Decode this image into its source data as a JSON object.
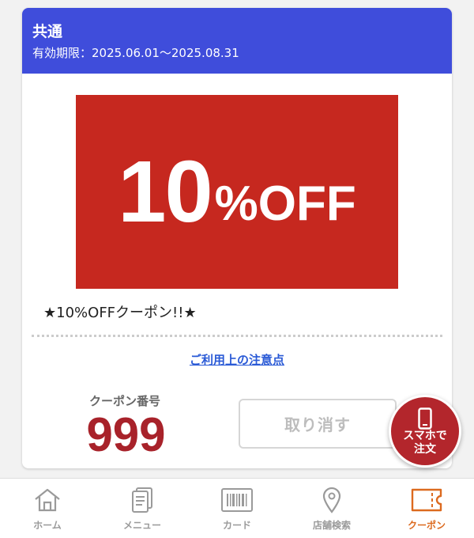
{
  "coupon": {
    "category": "共通",
    "validity": "有効期限：2025.06.01～2025.08.31",
    "banner_number": "10",
    "banner_suffix": "%OFF",
    "name": "★10%OFFクーポン!!★",
    "notes_link": "ご利用上の注意点",
    "number_label": "クーポン番号",
    "number_value": "999",
    "cancel_label": "取り消す"
  },
  "float_button": {
    "line1": "スマホで",
    "line2": "注文"
  },
  "bottom_nav": {
    "items": [
      {
        "label": "ホーム",
        "icon": "home-icon",
        "active": false
      },
      {
        "label": "メニュー",
        "icon": "menu-icon",
        "active": false
      },
      {
        "label": "カード",
        "icon": "barcode-card-icon",
        "active": false
      },
      {
        "label": "店舗検索",
        "icon": "location-pin-icon",
        "active": false
      },
      {
        "label": "クーポン",
        "icon": "coupon-ticket-icon",
        "active": true
      }
    ]
  },
  "colors": {
    "header_blue": "#3f4ddb",
    "banner_red": "#c6281f",
    "number_red": "#a8222a",
    "link_blue": "#2a5ad6",
    "active_orange": "#dc6a1f",
    "float_red": "#b3262c"
  }
}
